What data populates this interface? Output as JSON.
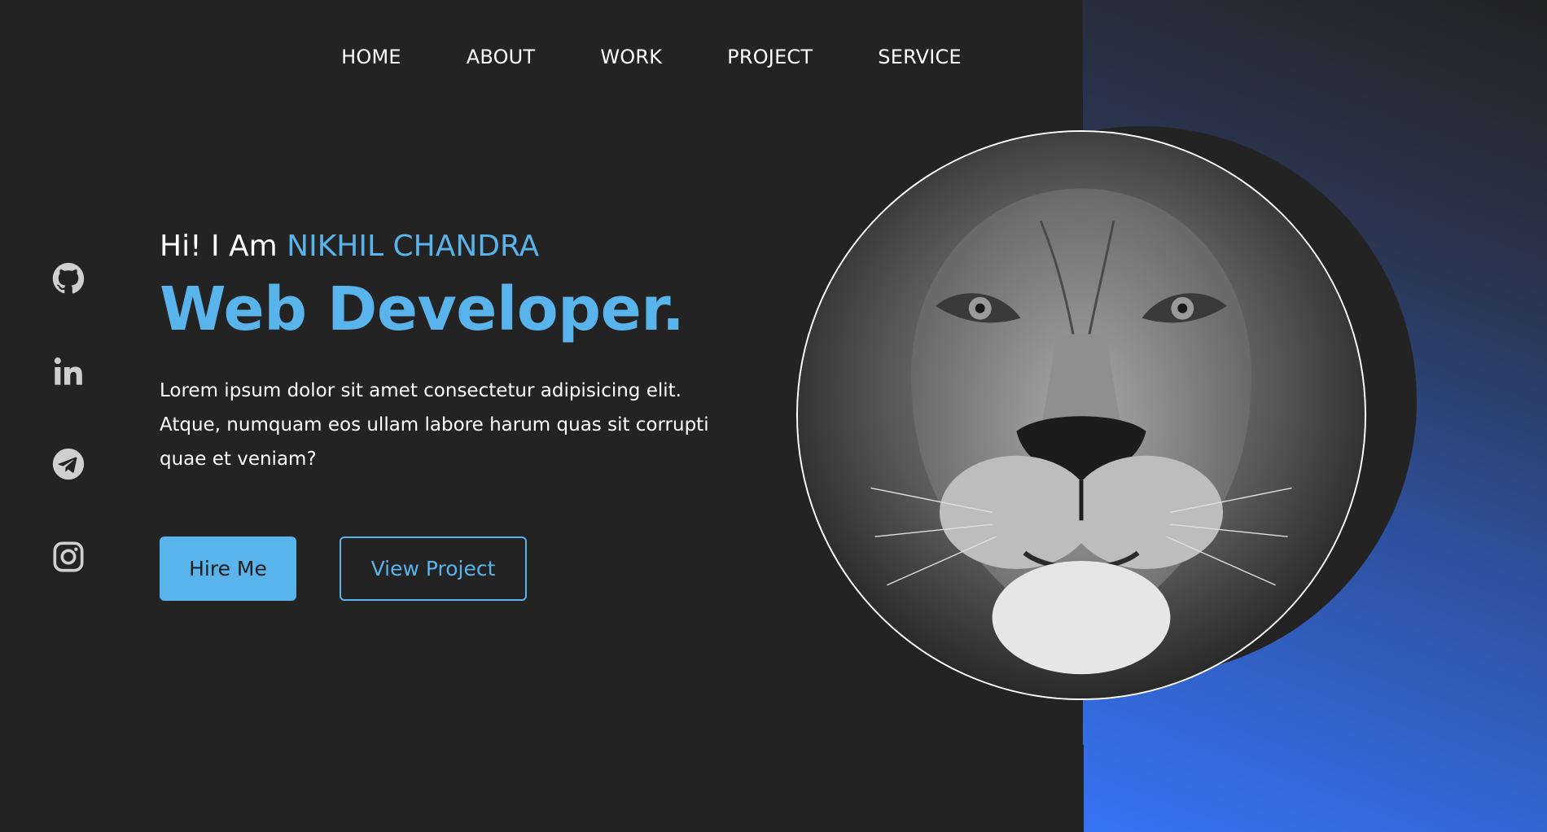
{
  "nav": {
    "items": [
      {
        "label": "HOME"
      },
      {
        "label": "ABOUT"
      },
      {
        "label": "WORK"
      },
      {
        "label": "PROJECT"
      },
      {
        "label": "SERVICE"
      }
    ]
  },
  "social": {
    "items": [
      {
        "icon": "github-icon"
      },
      {
        "icon": "linkedin-icon"
      },
      {
        "icon": "telegram-icon"
      },
      {
        "icon": "instagram-icon"
      }
    ]
  },
  "hero": {
    "greeting": "Hi! I Am ",
    "name": "NIKHIL CHANDRA",
    "title": "Web Developer.",
    "description": "Lorem ipsum dolor sit amet consectetur adipisicing elit. Atque, numquam eos ullam labore harum quas sit corrupti quae et veniam?",
    "hire_label": "Hire Me",
    "view_label": "View Project"
  },
  "colors": {
    "background": "#232323",
    "accent": "#5ab4ec",
    "gradient_end": "#3674f5"
  }
}
